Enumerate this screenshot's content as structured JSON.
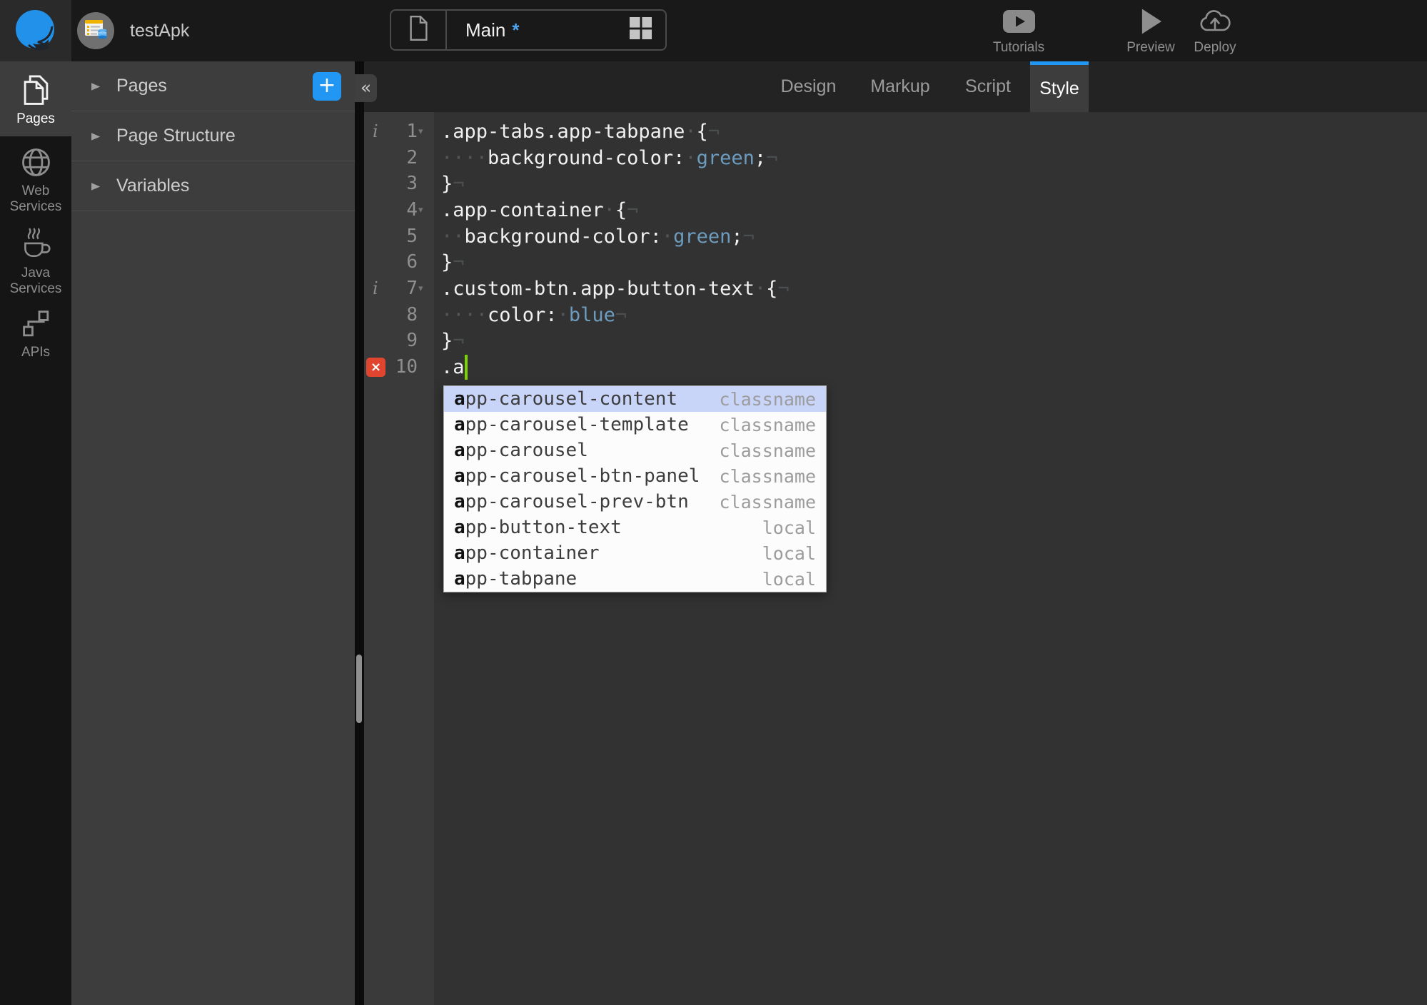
{
  "colors": {
    "accent": "#2196f3",
    "caret": "#7cd300",
    "error": "#e0452f",
    "code-value": "#6d9cbf",
    "ac-selection": "#c8d4f8"
  },
  "topbar": {
    "project_name": "testApk",
    "page_tab": {
      "label": "Main",
      "dirty_marker": "*"
    },
    "actions": [
      {
        "id": "tutorials",
        "label": "Tutorials",
        "icon": "tutorials-icon"
      },
      {
        "id": "preview",
        "label": "Preview",
        "icon": "preview-icon"
      },
      {
        "id": "deploy",
        "label": "Deploy",
        "icon": "deploy-icon"
      }
    ]
  },
  "rail": {
    "items": [
      {
        "id": "pages",
        "label": "Pages",
        "icon": "pages-icon",
        "active": true
      },
      {
        "id": "web-services",
        "label": "Web Services",
        "icon": "globe-icon"
      },
      {
        "id": "java-services",
        "label": "Java Services",
        "icon": "coffee-icon"
      },
      {
        "id": "apis",
        "label": "APIs",
        "icon": "api-icon"
      }
    ]
  },
  "panel": {
    "collapse_glyph": "«",
    "expander_glyph": "▶",
    "add_glyph": "+",
    "sections": [
      {
        "id": "pages",
        "label": "Pages",
        "add_button": true
      },
      {
        "id": "page-structure",
        "label": "Page Structure"
      },
      {
        "id": "variables",
        "label": "Variables"
      }
    ]
  },
  "editor": {
    "tabs": [
      {
        "label": "Design"
      },
      {
        "label": "Markup"
      },
      {
        "label": "Script"
      },
      {
        "label": "Style",
        "active": true
      }
    ],
    "gutter": [
      {
        "n": "1",
        "info": true,
        "fold": true
      },
      {
        "n": "2"
      },
      {
        "n": "3"
      },
      {
        "n": "4",
        "fold": true
      },
      {
        "n": "5"
      },
      {
        "n": "6"
      },
      {
        "n": "7",
        "info": true,
        "fold": true
      },
      {
        "n": "8"
      },
      {
        "n": "9"
      },
      {
        "n": "10",
        "error": true
      }
    ],
    "code_lines": [
      [
        [
          ".app-tabs.app-tabpane",
          "p"
        ],
        [
          "·",
          "w"
        ],
        [
          "{",
          "p"
        ],
        [
          "¬",
          "e"
        ]
      ],
      [
        [
          "····",
          "w"
        ],
        [
          "background-color:",
          "p"
        ],
        [
          "·",
          "w"
        ],
        [
          "green",
          "v"
        ],
        [
          ";",
          "p"
        ],
        [
          "¬",
          "e"
        ]
      ],
      [
        [
          "}",
          "p"
        ],
        [
          "¬",
          "e"
        ]
      ],
      [
        [
          ".app-container",
          "p"
        ],
        [
          "·",
          "w"
        ],
        [
          "{",
          "p"
        ],
        [
          "¬",
          "e"
        ]
      ],
      [
        [
          "··",
          "w"
        ],
        [
          "background-color:",
          "p"
        ],
        [
          "·",
          "w"
        ],
        [
          "green",
          "v"
        ],
        [
          ";",
          "p"
        ],
        [
          "¬",
          "e"
        ]
      ],
      [
        [
          "}",
          "p"
        ],
        [
          "¬",
          "e"
        ]
      ],
      [
        [
          ".custom-btn.app-button-text",
          "p"
        ],
        [
          "·",
          "w"
        ],
        [
          "{",
          "p"
        ],
        [
          "¬",
          "e"
        ]
      ],
      [
        [
          "····",
          "w"
        ],
        [
          "color:",
          "p"
        ],
        [
          "·",
          "w"
        ],
        [
          "blue",
          "v"
        ],
        [
          "¬",
          "e"
        ]
      ],
      [
        [
          "}",
          "p"
        ],
        [
          "¬",
          "e"
        ]
      ],
      [
        [
          ".a",
          "p"
        ]
      ]
    ],
    "caret_line": 10,
    "autocomplete": {
      "typed_prefix": "a",
      "items": [
        {
          "name": "app-carousel-content",
          "meta": "classname",
          "selected": true
        },
        {
          "name": "app-carousel-template",
          "meta": "classname"
        },
        {
          "name": "app-carousel",
          "meta": "classname"
        },
        {
          "name": "app-carousel-btn-panel",
          "meta": "classname"
        },
        {
          "name": "app-carousel-prev-btn",
          "meta": "classname"
        },
        {
          "name": "app-button-text",
          "meta": "local"
        },
        {
          "name": "app-container",
          "meta": "local"
        },
        {
          "name": "app-tabpane",
          "meta": "local"
        }
      ]
    }
  }
}
